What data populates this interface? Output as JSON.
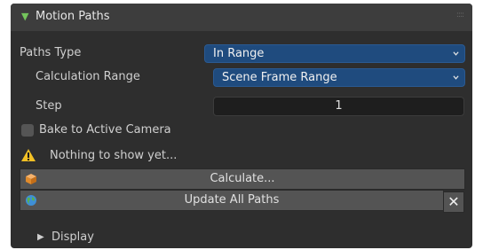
{
  "panel": {
    "title": "Motion Paths",
    "paths_type_label": "Paths Type",
    "paths_type_value": "In Range",
    "calc_range_label": "Calculation Range",
    "calc_range_value": "Scene Frame Range",
    "step_label": "Step",
    "step_value": "1",
    "bake_label": "Bake to Active Camera",
    "bake_checked": false,
    "warning_text": "Nothing to show yet...",
    "calculate_label": "Calculate...",
    "update_label": "Update All Paths",
    "close_glyph": "✕",
    "display_label": "Display"
  },
  "colors": {
    "panel_bg": "#2e2e2e",
    "header_bg": "#3d3d3d",
    "dropdown_bg": "#1f4b7e",
    "button_bg": "#545454",
    "accent_green": "#74c55c",
    "warning_yellow": "#f2c025"
  }
}
